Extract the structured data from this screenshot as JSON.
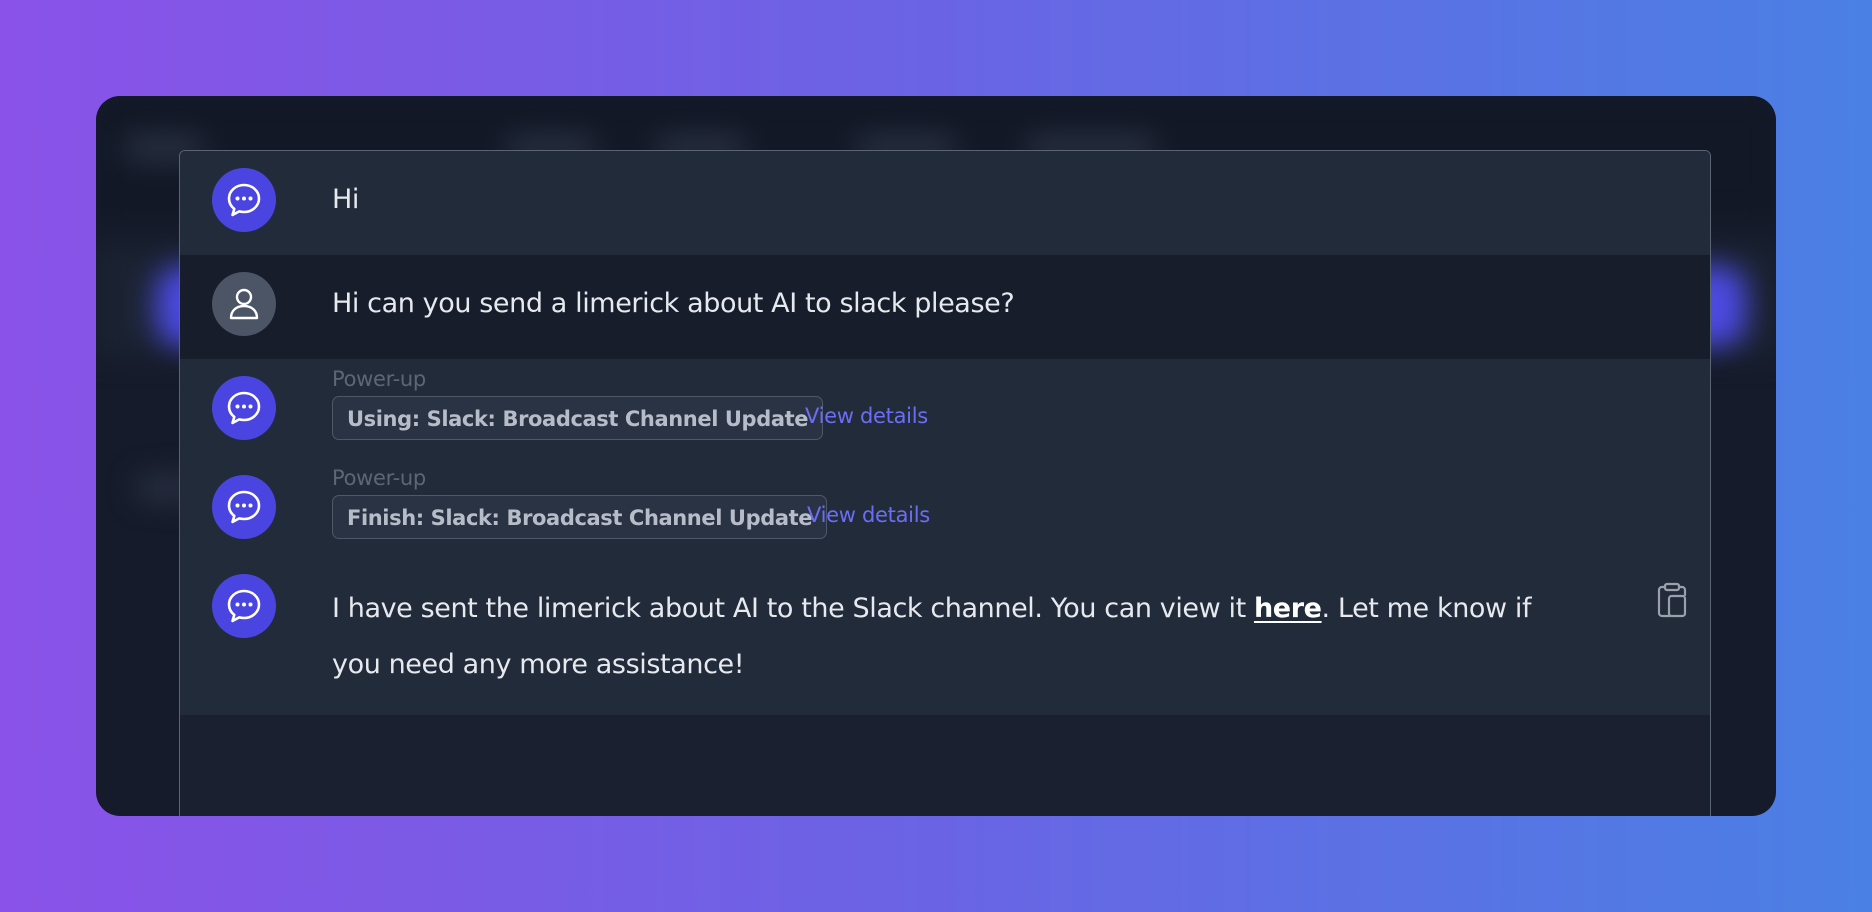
{
  "conversation": {
    "messages": [
      {
        "role": "assistant",
        "text": "Hi"
      },
      {
        "role": "user",
        "text": "Hi can you send a limerick about AI to slack please?"
      }
    ],
    "powerups": [
      {
        "label": "Power-up",
        "chip": "Using: Slack: Broadcast Channel Update",
        "link": "View details"
      },
      {
        "label": "Power-up",
        "chip": "Finish: Slack: Broadcast Channel Update",
        "link": "View details"
      }
    ],
    "final_message": {
      "before_link": "I have sent the limerick about AI to the Slack channel. You can view it ",
      "link_text": "here",
      "after_link": ". Let me know if you need any more assistance!"
    }
  },
  "icons": {
    "assistant_avatar": "chat-bubble-icon",
    "user_avatar": "user-icon",
    "copy": "clipboard-icon"
  },
  "colors": {
    "accent": "#4a45e0",
    "link": "#6b6ef4",
    "panel": "#222b3a",
    "background_gradient_start": "#8a52e8",
    "background_gradient_end": "#4a80e4"
  }
}
